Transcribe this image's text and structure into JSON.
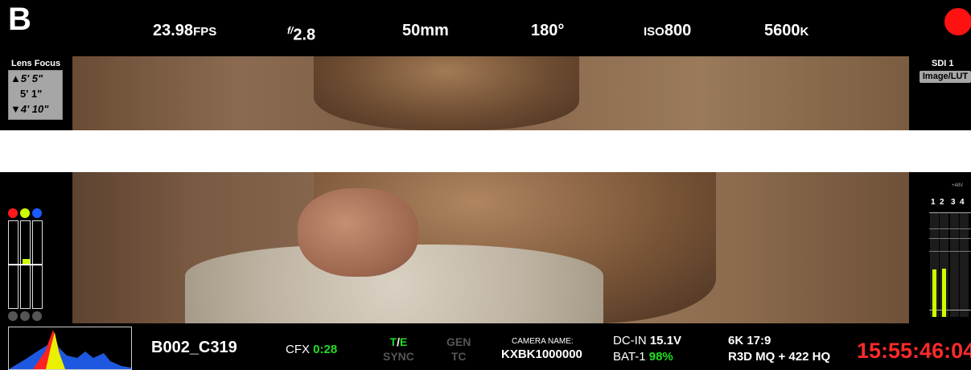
{
  "top_bar": {
    "camera_letter": "B",
    "fps_value": "23.98",
    "fps_unit": "FPS",
    "f_prefix": "f/",
    "f_value": "2.8",
    "lens_value": "50mm",
    "shutter_value": "180°",
    "iso_prefix": "ISO",
    "iso_value": "800",
    "wb_value": "5600",
    "wb_unit": "K",
    "record_color": "#ff1111"
  },
  "lens_focus": {
    "title": "Lens Focus",
    "far": "▲5' 5\"",
    "current": "5' 1\"",
    "near": "▼4' 10\""
  },
  "sdi": {
    "title": "SDI 1",
    "mode": "Image/LUT"
  },
  "rgb_meter": {
    "colors": [
      "#ff1a1a",
      "#ccff00",
      "#1a5cff"
    ]
  },
  "audio": {
    "channels": [
      "1",
      "2",
      "3",
      "4"
    ],
    "phantom_label": "+48V",
    "levels": [
      0.45,
      0.46,
      0.0,
      0.0
    ],
    "meter_color": "#ccff00"
  },
  "bottom_bar": {
    "clip_name": "B002_C319",
    "cfx_label": "CFX",
    "cfx_value": "0:28",
    "te_t": "T",
    "te_slash": "/",
    "te_e": "E",
    "sync": "SYNC",
    "gen": "GEN",
    "tc_label": "TC",
    "camera_name_label": "CAMERA NAME:",
    "camera_name_value": "KXBK1000000",
    "dcin_label": "DC-IN",
    "dcin_value": "15.1V",
    "bat_label": "BAT-1",
    "bat_value": "98%",
    "format_res": "6K 17:9",
    "format_codec": "R3D MQ + 422 HQ",
    "timecode": "15:55:46:04",
    "timecode_color": "#ff2a2a",
    "status_green": "#22dd22"
  }
}
